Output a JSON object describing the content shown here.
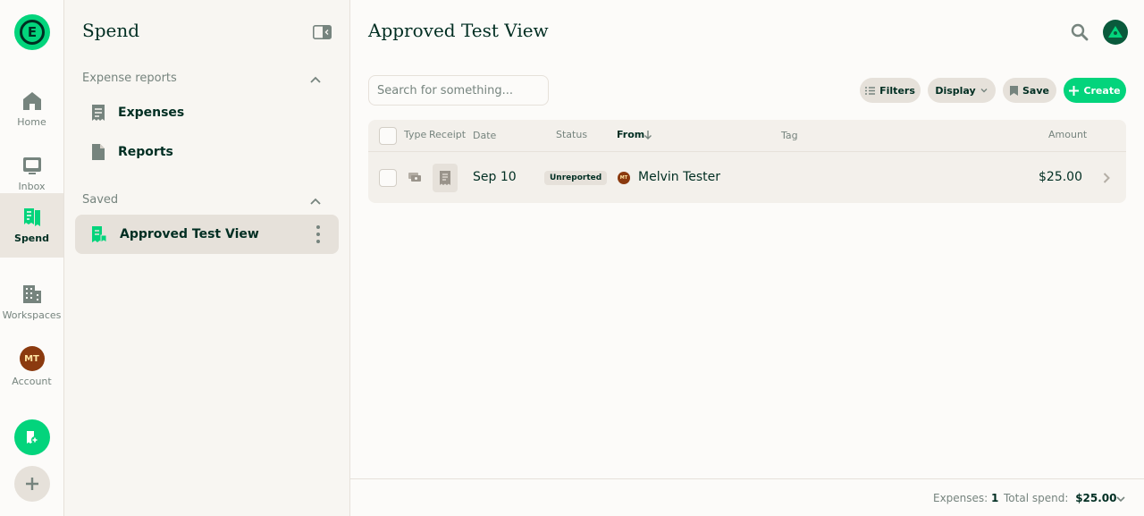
{
  "nav": {
    "logo_letter": "E",
    "items": [
      {
        "label": "Home"
      },
      {
        "label": "Inbox"
      },
      {
        "label": "Spend"
      },
      {
        "label": "Workspaces"
      },
      {
        "label": "Account",
        "avatar_initials": "MT"
      }
    ],
    "active": "Spend"
  },
  "sidebar": {
    "title": "Spend",
    "sections": [
      {
        "heading": "Expense reports",
        "items": [
          {
            "label": "Expenses"
          },
          {
            "label": "Reports"
          }
        ]
      },
      {
        "heading": "Saved",
        "items": [
          {
            "label": "Approved Test View"
          }
        ]
      }
    ]
  },
  "main": {
    "title": "Approved Test View",
    "search": {
      "placeholder": "Search for something..."
    },
    "toolbar": {
      "filters_label": "Filters",
      "display_label": "Display",
      "save_label": "Save",
      "create_label": "Create"
    },
    "table": {
      "headers": {
        "type": "Type",
        "receipt": "Receipt",
        "date": "Date",
        "status": "Status",
        "from": "From",
        "tag": "Tag",
        "amount": "Amount"
      },
      "sort_column": "From",
      "sort_direction": "descending",
      "rows": [
        {
          "date": "Sep 10",
          "status": "Unreported",
          "from": "Melvin Tester",
          "from_initials": "MT",
          "tag": "",
          "amount": "$25.00"
        }
      ]
    },
    "footer": {
      "expenses_label": "Expenses:",
      "expenses_count": "1",
      "total_label": "Total spend:",
      "total_value": "$25.00"
    }
  },
  "colors": {
    "accent": "#03d47c",
    "text": "#002e22",
    "muted": "#76847e",
    "border": "#e6e1da"
  }
}
